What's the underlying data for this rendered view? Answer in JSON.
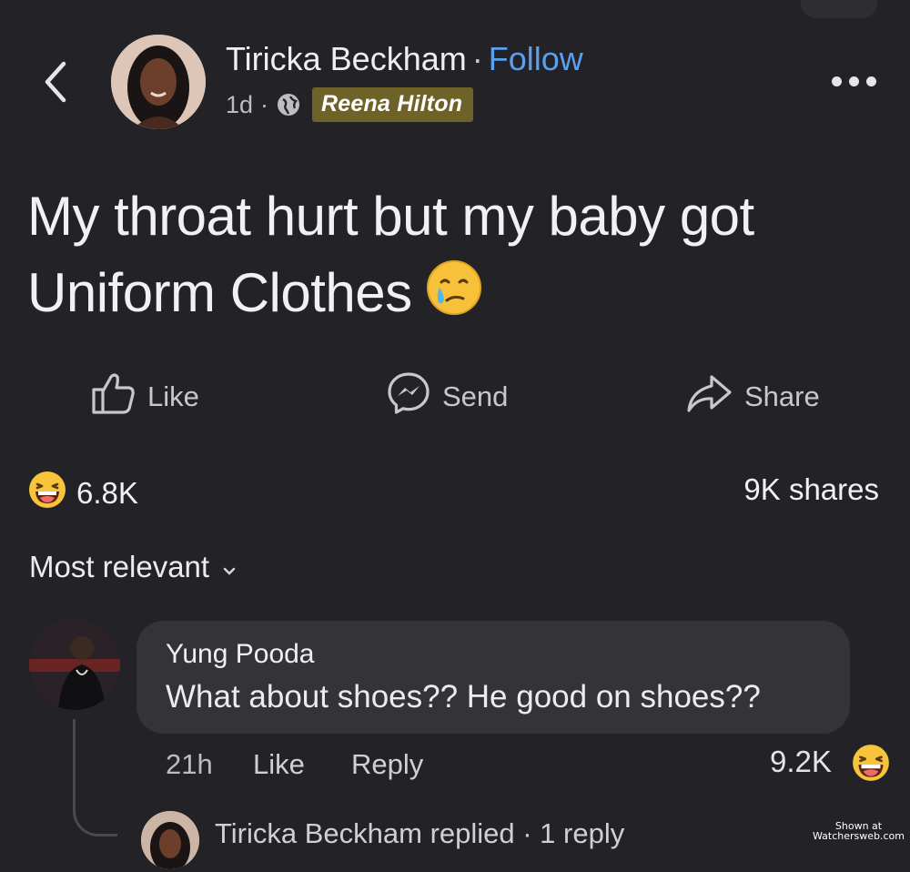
{
  "post": {
    "author": "Tiricka Beckham",
    "separator": "·",
    "follow_label": "Follow",
    "time": "1d",
    "meta_separator": "·",
    "badge": "Reena Hilton",
    "text": "My throat hurt but my baby got Uniform Clothes",
    "text_emoji": "face-holding-back-tears"
  },
  "actions": {
    "like_label": "Like",
    "send_label": "Send",
    "share_label": "Share"
  },
  "stats": {
    "reaction_count": "6.8K",
    "shares": "9K shares"
  },
  "comments": {
    "sort_label": "Most relevant",
    "items": [
      {
        "author": "Yung Pooda",
        "text": "What about shoes?? He good on shoes??",
        "time": "21h",
        "like_label": "Like",
        "reply_label": "Reply",
        "reaction_count": "9.2K"
      }
    ],
    "reply_summary": "Tiricka Beckham replied · 1 reply"
  },
  "watermark": {
    "line1": "Shown at",
    "line2": "Watchersweb.com"
  },
  "colors": {
    "background": "#232226",
    "follow_link": "#5aa0ec",
    "badge_bg": "#6e6228",
    "bubble_bg": "#343338"
  }
}
